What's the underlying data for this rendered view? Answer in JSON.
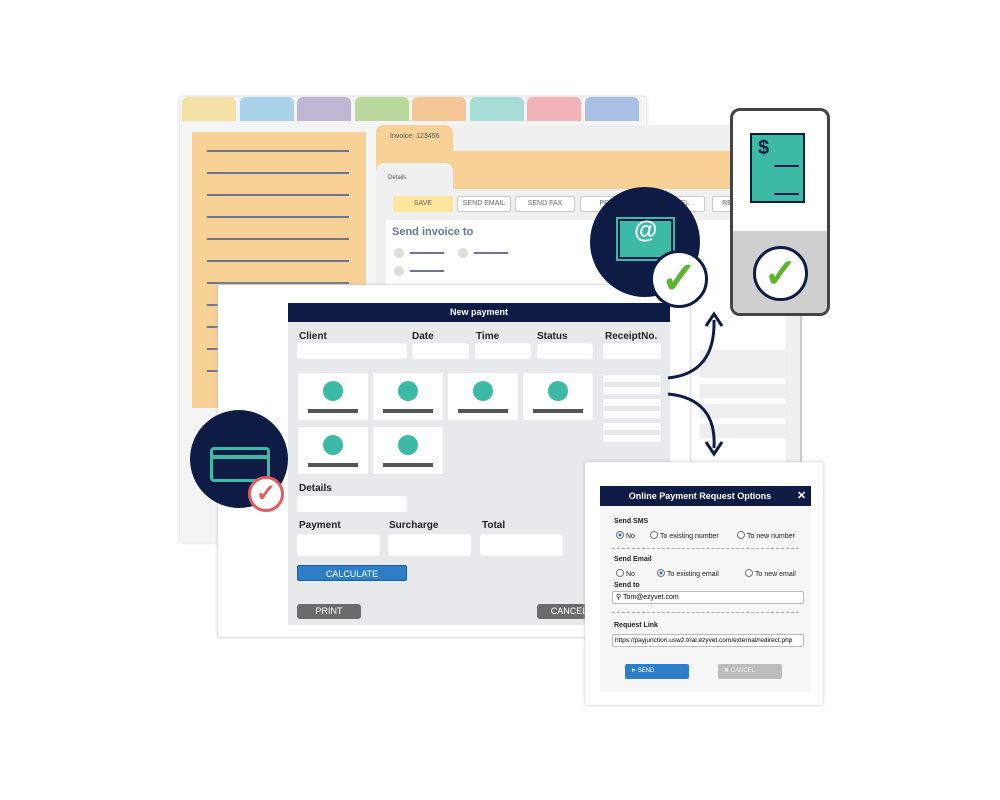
{
  "tabs_colors": [
    "#f3e1a6",
    "#a9d3ea",
    "#bdb7d4",
    "#bad79c",
    "#f2c794",
    "#a6ddd6",
    "#f2b3b8",
    "#a9c0e4"
  ],
  "invoice": {
    "tab_label": "Invoice: 123456",
    "subtab_label": "Details",
    "buttons": [
      "SAVE",
      "SEND EMAIL",
      "SEND FAX",
      "PRINT",
      "CANCEL",
      "RE"
    ],
    "heading": "Send invoice to"
  },
  "payment": {
    "title": "New payment",
    "columns": [
      "Client",
      "Date",
      "Time",
      "Status",
      "ReceiptNo."
    ],
    "details_label": "Details",
    "payment_label": "Payment",
    "surcharge_label": "Surcharge",
    "total_label": "Total",
    "calculate": "CALCULATE",
    "print": "PRINT",
    "cancel": "CANCEL"
  },
  "dialog": {
    "title": "Online Payment Request Options",
    "close": "✕",
    "sms_label": "Send SMS",
    "sms_options": [
      "No",
      "To existing number",
      "To new number"
    ],
    "sms_selected": "No",
    "email_label": "Send Email",
    "email_options": [
      "No",
      "To existing email",
      "To new email"
    ],
    "email_selected": "To existing email",
    "send_to_label": "Send to",
    "send_to_value": "Tom@ezyvet.com",
    "link_label": "Request Link",
    "link_value": "https://payjunction.usw2.trial.ezyvet.com/external/redirect.php",
    "send": "SEND",
    "cancel": "CANCEL"
  },
  "icons": {
    "email": "@",
    "dollar": "$"
  },
  "colors": {
    "navy": "#0e1c45",
    "teal": "#3dbaa6",
    "green": "#5cb531",
    "orange": "#f7d196",
    "blue": "#2d7ec6"
  }
}
